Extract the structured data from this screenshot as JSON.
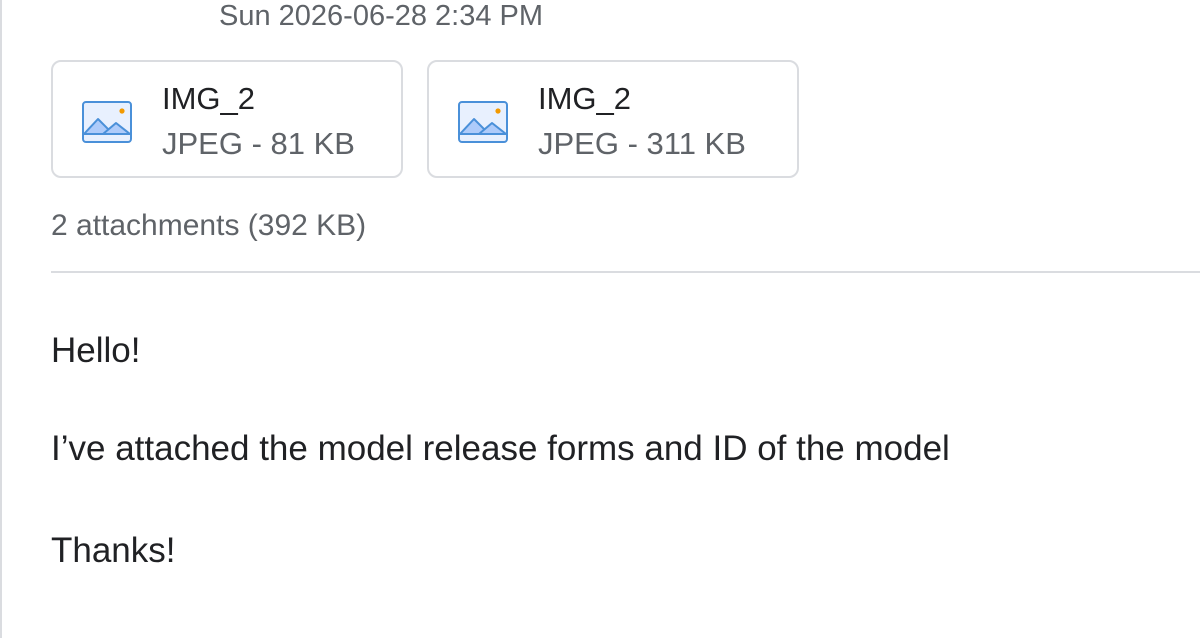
{
  "email": {
    "timestamp": "Sun 2026-06-28 2:34 PM",
    "attachments": [
      {
        "name": "IMG_2",
        "meta": "JPEG - 81 KB",
        "icon": "image-file-icon"
      },
      {
        "name": "IMG_2",
        "meta": "JPEG - 311 KB",
        "icon": "image-file-icon"
      }
    ],
    "attachments_summary": "2 attachments (392 KB)",
    "body": {
      "greeting": "Hello!",
      "message": "I’ve attached the model release forms and ID of the model",
      "closing": "Thanks!"
    }
  },
  "colors": {
    "icon_blue": "#4a90d9",
    "icon_light_blue": "#aecbfa",
    "icon_orange": "#f29900",
    "border": "#dadce0",
    "secondary_text": "#5f6368"
  }
}
